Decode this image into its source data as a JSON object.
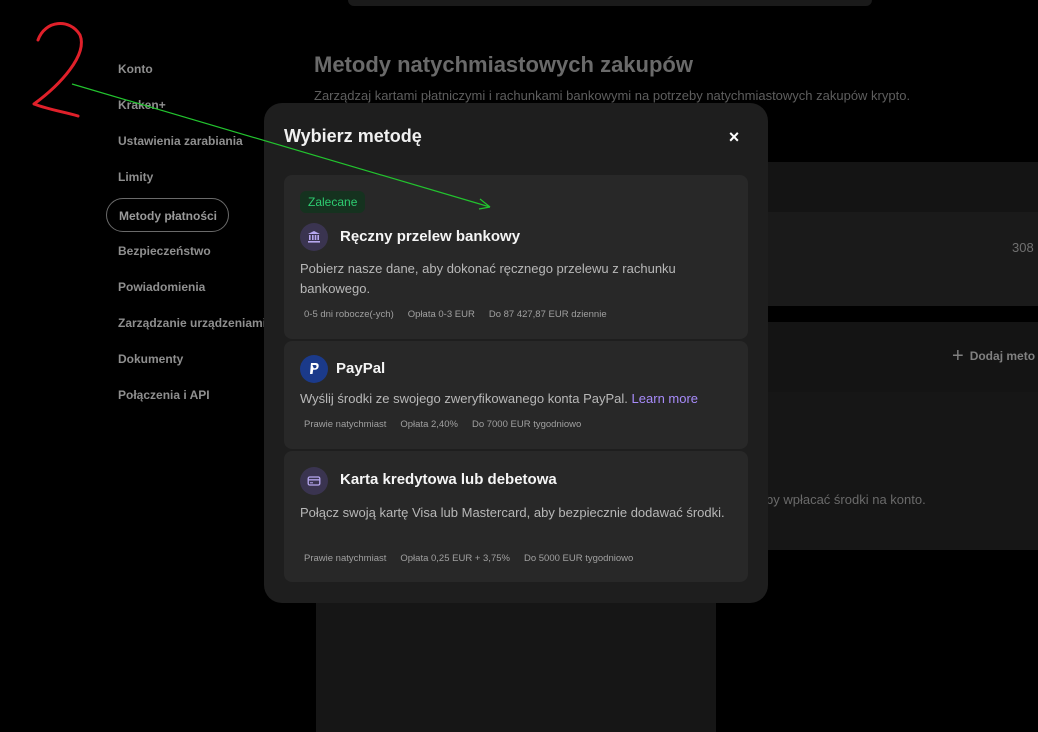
{
  "sidebar": {
    "items": [
      {
        "label": "Konto"
      },
      {
        "label": "Kraken+"
      },
      {
        "label": "Ustawienia zarabiania"
      },
      {
        "label": "Limity"
      },
      {
        "label": "Metody płatności"
      },
      {
        "label": "Bezpieczeństwo"
      },
      {
        "label": "Powiadomienia"
      },
      {
        "label": "Zarządzanie urządzeniami"
      },
      {
        "label": "Dokumenty"
      },
      {
        "label": "Połączenia i API"
      }
    ]
  },
  "page": {
    "title": "Metody natychmiastowych zakupów",
    "subtitle": "Zarządzaj kartami płatniczymi i rachunkami bankowymi na potrzeby natychmiastowych zakupów krypto.",
    "partial_number": "308",
    "add_method_label": "Dodaj meto",
    "deposit_text": "by wpłacać środki na konto."
  },
  "modal": {
    "title": "Wybierz metodę",
    "close_label": "×",
    "methods": [
      {
        "badge": "Zalecane",
        "title": "Ręczny przelew bankowy",
        "description": "Pobierz nasze dane, aby dokonać ręcznego przelewu z rachunku bankowego.",
        "meta": [
          "0-5 dni robocze(-ych)",
          "Opłata 0-3 EUR",
          "Do 87 427,87 EUR dziennie"
        ]
      },
      {
        "title": "PayPal",
        "description": "Wyślij środki ze swojego zweryfikowanego konta PayPal.",
        "link": "Learn more",
        "meta": [
          "Prawie natychmiast",
          "Opłata 2,40%",
          "Do 7000 EUR tygodniowo"
        ]
      },
      {
        "title": "Karta kredytowa lub debetowa",
        "description": "Połącz swoją kartę Visa lub Mastercard, aby bezpiecznie dodawać środki.",
        "meta": [
          "Prawie natychmiast",
          "Opłata 0,25 EUR + 3,75%",
          "Do 5000 EUR tygodniowo"
        ]
      }
    ]
  },
  "annotation": {
    "handwritten_number": "2",
    "colors": {
      "number": "#e0202a",
      "arrow": "#22c32e"
    }
  },
  "colors": {
    "accent_link": "#a78bfa",
    "badge_green": "#2ecc71",
    "modal_bg": "#1e1e1e"
  }
}
